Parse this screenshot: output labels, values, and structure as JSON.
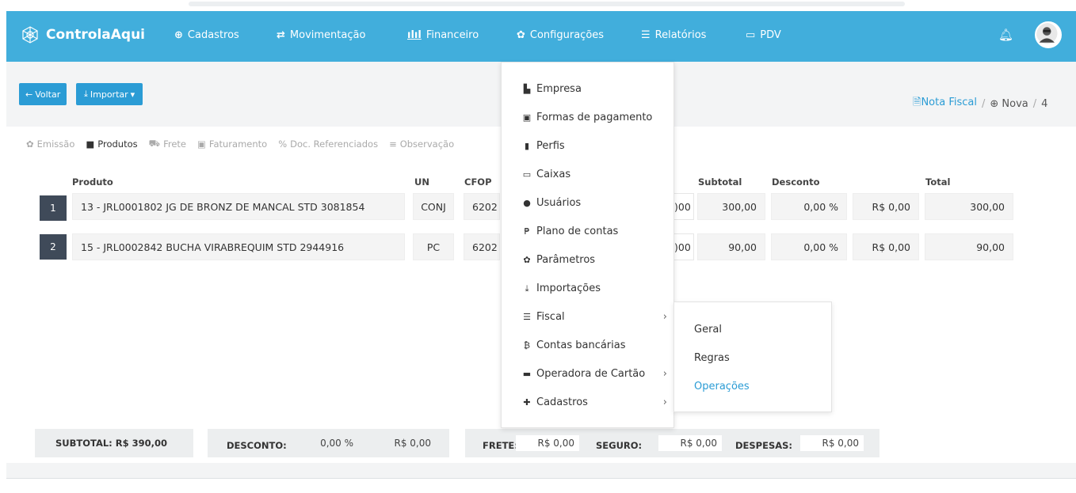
{
  "navbar": {
    "brand": "ControlaAqui",
    "items": [
      {
        "label": "Cadastros",
        "icon": "plus-circle-icon"
      },
      {
        "label": "Movimentação",
        "icon": "retweet-icon"
      },
      {
        "label": "Financeiro",
        "icon": "bar-chart-icon"
      },
      {
        "label": "Configurações",
        "icon": "gear-icon"
      },
      {
        "label": "Relatórios",
        "icon": "list-icon"
      },
      {
        "label": "PDV",
        "icon": "laptop-icon"
      }
    ],
    "colors": {
      "bg": "#41aedc",
      "accent": "#2b9cd5"
    }
  },
  "toolbar": {
    "voltar_label": "Voltar",
    "importar_label": "Importar"
  },
  "breadcrumb": {
    "link": "Nota Fiscal",
    "current": "Nova",
    "tail": "4"
  },
  "tabs": [
    {
      "label": "Emissão"
    },
    {
      "label": "Produtos"
    },
    {
      "label": "Frete"
    },
    {
      "label": "Faturamento"
    },
    {
      "label": "Doc. Referenciados"
    },
    {
      "label": "Observação"
    }
  ],
  "table": {
    "headers": {
      "produto": "Produto",
      "un": "UN",
      "cfop": "CFOP",
      "subtotal": "Subtotal",
      "desconto": "Desconto",
      "total": "Total"
    },
    "rows": [
      {
        "num": "1",
        "produto": "13 - JRL0001802 JG DE BRONZ DE MANCAL STD 3081854",
        "un": "CONJ",
        "cfop": "6202",
        "hidden": ")00",
        "subtotal": "300,00",
        "desconto_pct": "0,00 %",
        "desconto_val": "R$ 0,00",
        "total": "300,00"
      },
      {
        "num": "2",
        "produto": "15 - JRL0002842 BUCHA VIRABREQUIM STD 2944916",
        "un": "PC",
        "cfop": "6202",
        "hidden": ")00",
        "subtotal": "90,00",
        "desconto_pct": "0,00 %",
        "desconto_val": "R$ 0,00",
        "total": "90,00"
      }
    ]
  },
  "summary": {
    "subtotal": "SUBTOTAL: R$ 390,00",
    "desconto_label": "DESCONTO:",
    "desconto_pct": "0,00 %",
    "desconto_val": "R$ 0,00",
    "frete_label": "FRETE:",
    "frete_val": "R$ 0,00",
    "seguro_label": "SEGURO:",
    "seguro_val": "R$ 0,00",
    "despesas_label": "DESPESAS:",
    "despesas_val": "R$ 0,00"
  },
  "config_menu": {
    "items": [
      {
        "label": "Empresa",
        "icon": "building-icon"
      },
      {
        "label": "Formas de pagamento",
        "icon": "money-icon"
      },
      {
        "label": "Perfis",
        "icon": "id-card-icon"
      },
      {
        "label": "Caixas",
        "icon": "laptop-icon"
      },
      {
        "label": "Usuários",
        "icon": "user-icon"
      },
      {
        "label": "Plano de contas",
        "icon": "peso-icon"
      },
      {
        "label": "Parâmetros",
        "icon": "gear-icon"
      },
      {
        "label": "Importações",
        "icon": "download-icon"
      },
      {
        "label": "Fiscal",
        "icon": "list-icon"
      },
      {
        "label": "Contas bancárias",
        "icon": "bitcoin-icon"
      },
      {
        "label": "Operadora de Cartão",
        "icon": "credit-card-icon"
      },
      {
        "label": "Cadastros",
        "icon": "plus-icon"
      }
    ]
  },
  "fiscal_submenu": {
    "items": [
      {
        "label": "Geral"
      },
      {
        "label": "Regras"
      },
      {
        "label": "Operações"
      }
    ]
  }
}
